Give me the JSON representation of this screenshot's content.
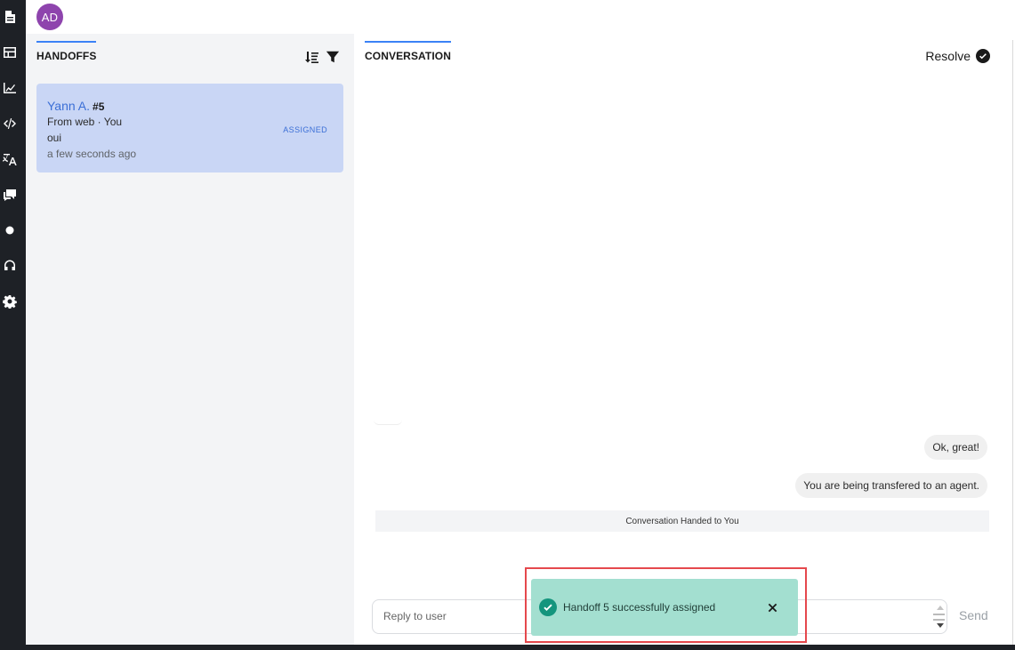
{
  "user": {
    "initials": "AD",
    "avatar_color": "#8e44ad"
  },
  "sidebar": {
    "items": [
      {
        "icon": "document-icon"
      },
      {
        "icon": "layout-icon"
      },
      {
        "icon": "chart-line-icon"
      },
      {
        "icon": "code-icon"
      },
      {
        "icon": "translate-icon"
      },
      {
        "icon": "chat-icon"
      },
      {
        "icon": "dot-icon"
      },
      {
        "icon": "headset-icon"
      },
      {
        "icon": "gear-icon"
      }
    ]
  },
  "handoffs": {
    "tab_label": "HANDOFFS",
    "sort_icon": "sort-icon",
    "filter_icon": "filter-icon",
    "items": [
      {
        "name": "Yann A.",
        "number": "#5",
        "source": "From web · You",
        "last_message": "oui",
        "time": "a few seconds ago",
        "status": "ASSIGNED"
      }
    ]
  },
  "conversation": {
    "tab_label": "CONVERSATION",
    "resolve_label": "Resolve",
    "messages": [
      {
        "text": "Ok, great!"
      },
      {
        "text": "You are being transfered to an agent."
      }
    ],
    "system_message": "Conversation Handed to You",
    "reply_placeholder": "Reply to user",
    "send_label": "Send"
  },
  "toast": {
    "message": "Handoff 5 successfully assigned",
    "color": "#a3dfd0",
    "check_color": "#14957d"
  },
  "colors": {
    "accent": "#3b82f6",
    "sidebar": "#1e2126",
    "card": "#c9d6f5"
  }
}
